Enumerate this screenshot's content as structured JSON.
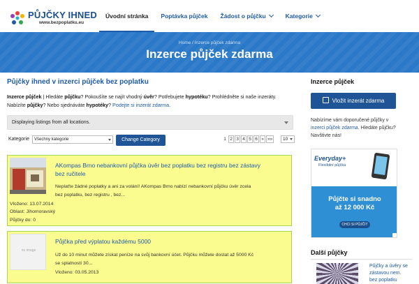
{
  "header": {
    "logo_title": "PŮJČKY IHNED",
    "logo_sub": "www.bezpoplatku.eu",
    "nav": [
      {
        "label": "Úvodní stránka",
        "dropdown": false,
        "active": true
      },
      {
        "label": "Poptávka půjček",
        "dropdown": false,
        "active": false
      },
      {
        "label": "Žádost o půjčku",
        "dropdown": true,
        "active": false
      },
      {
        "label": "Kategorie",
        "dropdown": true,
        "active": false
      }
    ],
    "accent_color": "#1d5aa8"
  },
  "banner": {
    "breadcrumb": "Home / Inzerce půjček zdarma",
    "title": "Inzerce půjček zdarma",
    "background_color": "#2a78c8"
  },
  "main": {
    "heading": "Půjčky ihned v inzerci půjček bez poplatku",
    "intro": {
      "b1": "Inzerce půjček",
      "t1": " | Hledáte ",
      "b2": "půjčku",
      "t2": "? Pokoušíte se najít vhodný ",
      "b3": "úvěr",
      "t3": "? Potřebujete ",
      "b4": "hypotéku",
      "t4": "? Prohlédněte si naše inzeráty.",
      "t5": "Nabízíte ",
      "b5": "půjčky",
      "t6": "? Nebo sjednáváte ",
      "b6": "hypotéky",
      "t7": "? ",
      "link": "Podejte si inzerát zdarma",
      "t8": "."
    },
    "notice": "Displaying listings from all locations.",
    "filter": {
      "label": "Kategorie",
      "selected": "Všechny kategorie",
      "button": "Change Category"
    },
    "pagination": {
      "pages": [
        "1",
        "2",
        "3",
        "4",
        "5",
        "6",
        "»",
        "»»"
      ],
      "current": "1",
      "per_page": "10"
    },
    "listings": [
      {
        "title": "AKompas Brno nebankovní půjčka úvěr bez poplatku bez registru bez zástavy bez ručitele",
        "description": "Neplaťte žádné poplatky a ani za volání! AKompas Brno nabízí nebankovní půjčku úvěr zcela bez poplatku, bez registru , bez...",
        "date_label": "Vloženo:",
        "date": "13.07.2014",
        "region_label": "Oblast:",
        "region": "Jihomoravský",
        "amount_label": "Půjčky do:",
        "amount": "0",
        "image": "photo"
      },
      {
        "title": "Půjčka před výplatou každému 5000",
        "description": "Už do 10 minut můžete získat peníze na svůj bankovní účet. Půjčku můžete dostat až 5000 Kč se splatností 30...",
        "date_label": "Vloženo:",
        "date": "03.05.2013",
        "image": "no image",
        "no_image_text": "no image"
      }
    ],
    "listing_bg": "#fbfc8f",
    "listing_border": "#a9d650"
  },
  "sidebar": {
    "heading": "Inzerce půjček",
    "add_button": "Vložit inzerát zdarma",
    "text_before": "Nabízíme vám doporučené půjčky v ",
    "text_link": "inzerci půjček zdarma",
    "text_after": ". Hledáte půjčku? Navštivte nás!",
    "ad": {
      "brand": "Everyday+",
      "brand_sub": "Flexibilní půjčka",
      "line1": "Půjčte si snadno",
      "line2": "až 12 000 Kč",
      "button": "CHCI SI PŮJČIT"
    },
    "heading2": "Další půjčky",
    "more_link": "Půjčky a úvěry se zástavou nem. bez poplatku"
  }
}
